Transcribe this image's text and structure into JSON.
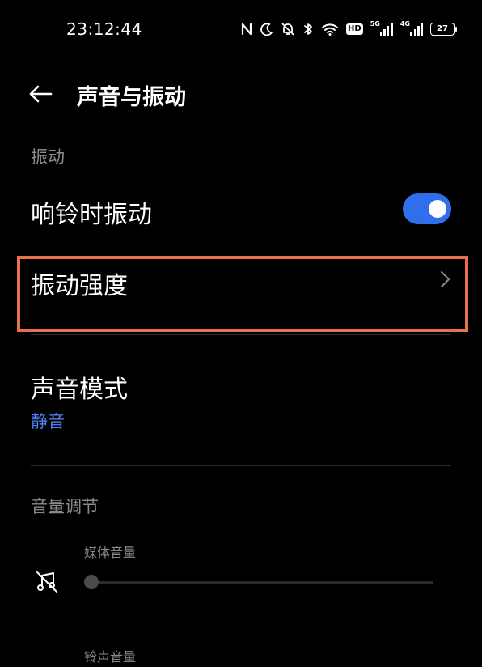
{
  "status_bar": {
    "time": "23:12:44",
    "icons": [
      "nfc-icon",
      "moon-icon",
      "bell-off-icon",
      "bluetooth-icon",
      "wifi-icon",
      "hd-icon",
      "signal-5g-icon",
      "signal-4g-icon",
      "battery-icon"
    ],
    "hd_label": "HD",
    "net1": "5G",
    "net2": "4G",
    "battery_level": "27"
  },
  "header": {
    "title": "声音与振动",
    "back_icon": "arrow-left-icon"
  },
  "vibration_section": {
    "label": "振动",
    "ring_vibrate": {
      "label": "响铃时振动",
      "enabled": true,
      "toggle_color": "#2f6fec"
    },
    "vibration_strength": {
      "label": "振动强度",
      "chevron_icon": "chevron-right-icon",
      "highlight_color": "#e8704d"
    }
  },
  "sound_mode": {
    "label": "声音模式",
    "value": "静音",
    "value_color": "#4f7ef2"
  },
  "volume_section": {
    "label": "音量调节",
    "media_volume": {
      "label": "媒体音量",
      "icon": "music-muted-icon",
      "level": 0
    },
    "ringtone_volume": {
      "label": "铃声音量"
    }
  }
}
